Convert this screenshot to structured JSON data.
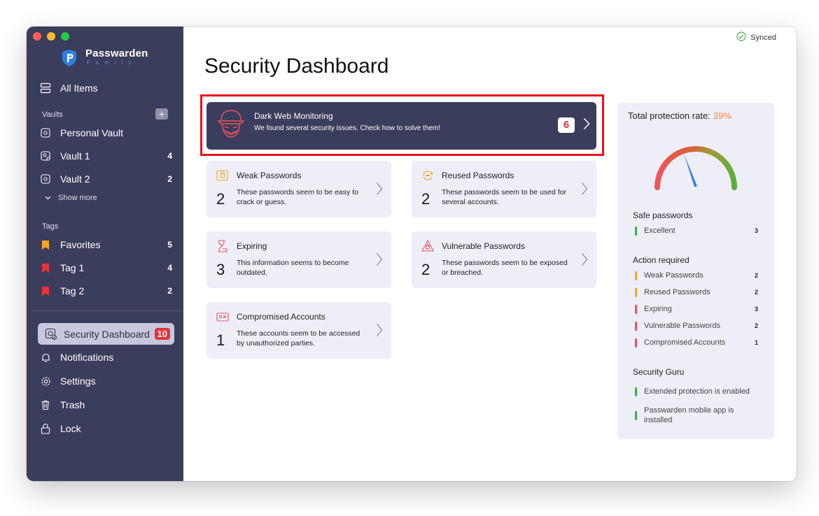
{
  "brand": {
    "name": "Passwarden",
    "subtitle": "Family"
  },
  "sidebar": {
    "all_items": "All Items",
    "vaults_label": "Vaults",
    "vaults": [
      {
        "label": "Personal Vault",
        "count": ""
      },
      {
        "label": "Vault 1",
        "count": "4"
      },
      {
        "label": "Vault 2",
        "count": "2"
      }
    ],
    "show_more": "Show more",
    "tags_label": "Tags",
    "tags": [
      {
        "label": "Favorites",
        "count": "5"
      },
      {
        "label": "Tag 1",
        "count": "4"
      },
      {
        "label": "Tag 2",
        "count": "2"
      }
    ],
    "security_dashboard": {
      "label": "Security Dashboard",
      "badge": "10"
    },
    "notifications": "Notifications",
    "settings": "Settings",
    "trash": "Trash",
    "lock": "Lock"
  },
  "header": {
    "synced": "Synced",
    "title": "Security Dashboard"
  },
  "dark_web": {
    "title": "Dark Web Monitoring",
    "subtitle": "We found several security issues. Check how to solve them!",
    "badge": "6"
  },
  "cards": [
    {
      "title": "Weak Passwords",
      "count": "2",
      "desc": "These passwords seem to be easy to crack or guess."
    },
    {
      "title": "Reused Passwords",
      "count": "2",
      "desc": "These passwords seem to be used for several accounts."
    },
    {
      "title": "Expiring",
      "count": "3",
      "desc": "This information seems to become outdated."
    },
    {
      "title": "Vulnerable Passwords",
      "count": "2",
      "desc": "These passwords seem to be exposed or breached."
    },
    {
      "title": "Compromised Accounts",
      "count": "1",
      "desc": "These accounts seem to be accessed by unauthorized parties."
    }
  ],
  "panel": {
    "rate_label": "Total protection rate:",
    "rate_value": "39%",
    "gauge_level": 0.39,
    "safe_heading": "Safe passwords",
    "safe": [
      {
        "label": "Excellent",
        "count": "3"
      }
    ],
    "action_heading": "Action required",
    "action": [
      {
        "label": "Weak Passwords",
        "count": "2"
      },
      {
        "label": "Reused Passwords",
        "count": "2"
      },
      {
        "label": "Expiring",
        "count": "3"
      },
      {
        "label": "Vulnerable Passwords",
        "count": "2"
      },
      {
        "label": "Compromised Accounts",
        "count": "1"
      }
    ],
    "guru_heading": "Security Guru",
    "guru": [
      {
        "label": "Extended protection is enabled"
      },
      {
        "label": "Passwarden mobile app is installed"
      }
    ]
  },
  "colors": {
    "sidebar_bg": "#3b3d5c",
    "accent_red": "#e8323c",
    "warning_orange": "#f5a623",
    "safe_green": "#3cb043",
    "danger_red": "#f0535a",
    "rate_orange": "#f08a3c"
  },
  "icons": {
    "all_items": "stack-icon",
    "vault": "vault-icon",
    "tag": "bookmark-icon",
    "security": "shield-icon",
    "notifications": "bell-icon",
    "settings": "gear-icon",
    "trash": "trash-icon",
    "lock": "lock-icon"
  }
}
